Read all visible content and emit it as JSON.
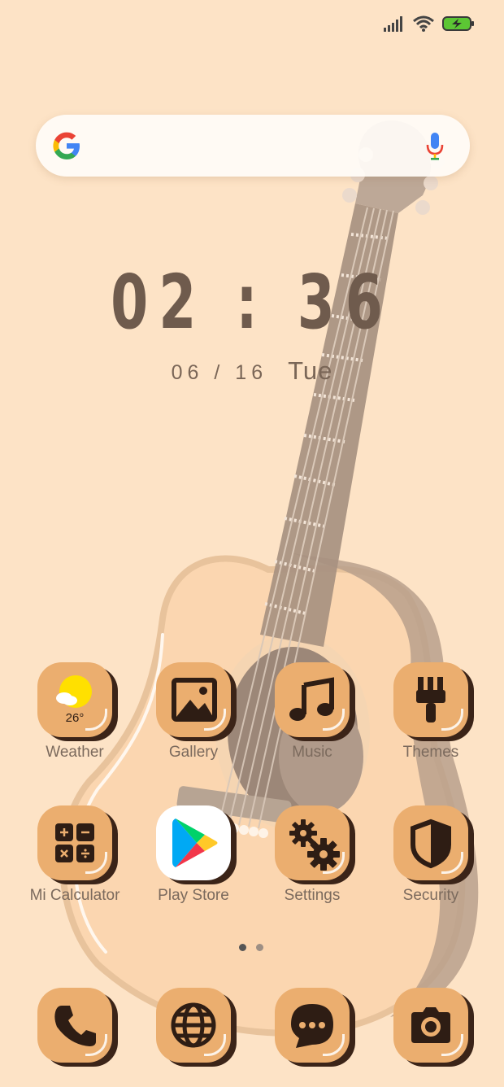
{
  "status_bar": {
    "signal_icon": "signal-bars-icon",
    "wifi_icon": "wifi-icon",
    "battery_icon": "battery-charging-icon",
    "battery_color": "#5cc634"
  },
  "search": {
    "logo_icon": "google-g-icon",
    "mic_icon": "mic-icon"
  },
  "clock": {
    "time": "02 : 36",
    "date": "06 / 16",
    "weekday": "Tue"
  },
  "weather": {
    "temperature": "26°"
  },
  "apps_row1": [
    {
      "label": "Weather",
      "icon": "weather-icon"
    },
    {
      "label": "Gallery",
      "icon": "gallery-icon"
    },
    {
      "label": "Music",
      "icon": "music-note-icon"
    },
    {
      "label": "Themes",
      "icon": "paintbrush-icon"
    }
  ],
  "apps_row2": [
    {
      "label": "Mi Calculator",
      "icon": "calculator-icon"
    },
    {
      "label": "Play Store",
      "icon": "play-store-icon"
    },
    {
      "label": "Settings",
      "icon": "gears-icon"
    },
    {
      "label": "Security",
      "icon": "shield-icon"
    }
  ],
  "dock": [
    {
      "icon": "phone-icon"
    },
    {
      "icon": "browser-globe-icon"
    },
    {
      "icon": "messages-icon"
    },
    {
      "icon": "camera-icon"
    }
  ],
  "page_indicator": {
    "pages": 2,
    "current": 1
  },
  "colors": {
    "background": "#fde3c6",
    "icon_tile": "#ebae6f",
    "icon_shadow": "#3b2418",
    "icon_glyph": "#2e1d14",
    "text": "#7b6a5d",
    "clock": "#6f5b4d"
  }
}
